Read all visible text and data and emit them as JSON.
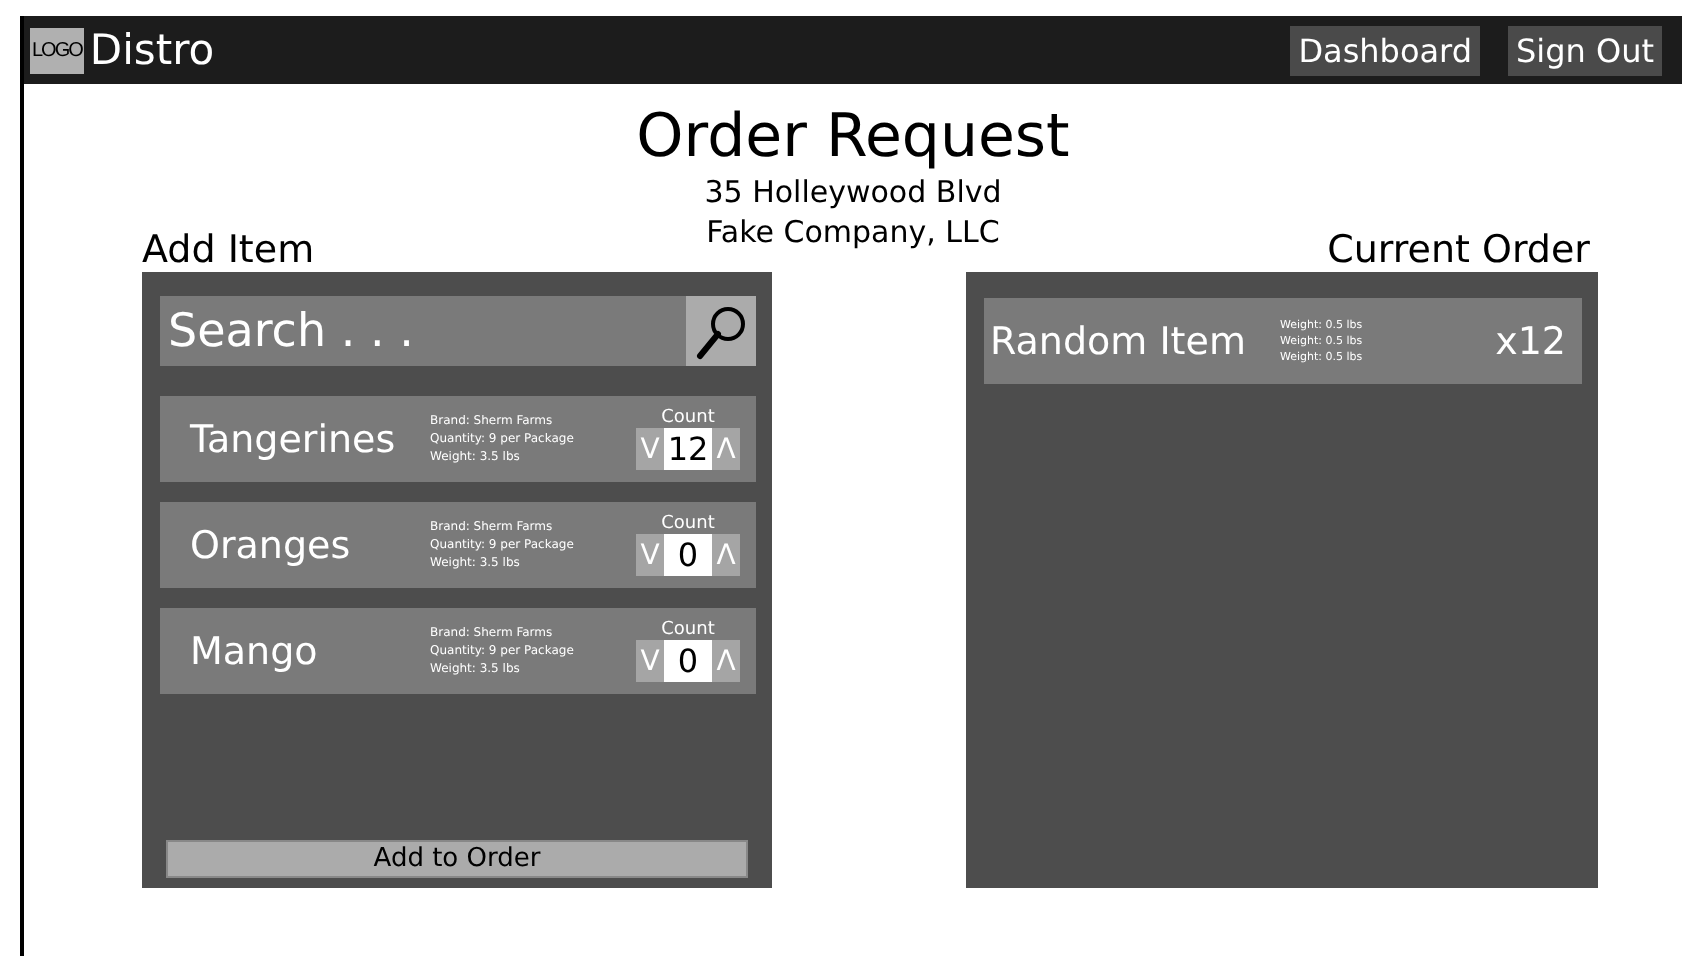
{
  "header": {
    "logo": "LOGO",
    "app_name": "Distro",
    "nav": [
      "Dashboard",
      "Sign Out"
    ]
  },
  "page": {
    "title": "Order Request",
    "address_lines": [
      "35 Holleywood Blvd",
      "Fake Company, LLC"
    ]
  },
  "add_item": {
    "heading": "Add Item",
    "search": {
      "placeholder": "Search . . ."
    },
    "items": [
      {
        "name": "Tangerines",
        "details": [
          "Brand:  Sherm Farms",
          "Quantity: 9 per Package",
          "Weight: 3.5 lbs"
        ],
        "count_label": "Count",
        "count": "12",
        "down": "V",
        "up": "Λ"
      },
      {
        "name": "Oranges",
        "details": [
          "Brand:  Sherm Farms",
          "Quantity: 9 per Package",
          "Weight: 3.5 lbs"
        ],
        "count_label": "Count",
        "count": "0",
        "down": "V",
        "up": "Λ"
      },
      {
        "name": "Mango",
        "details": [
          "Brand:  Sherm Farms",
          "Quantity: 9 per Package",
          "Weight: 3.5 lbs"
        ],
        "count_label": "Count",
        "count": "0",
        "down": "V",
        "up": "Λ"
      }
    ],
    "button": "Add to Order"
  },
  "current_order": {
    "heading": "Current Order",
    "items": [
      {
        "name": "Random Item",
        "details": [
          "Weight: 0.5 lbs",
          "Weight: 0.5 lbs",
          "Weight: 0.5 lbs"
        ],
        "quantity": "x12"
      }
    ]
  }
}
